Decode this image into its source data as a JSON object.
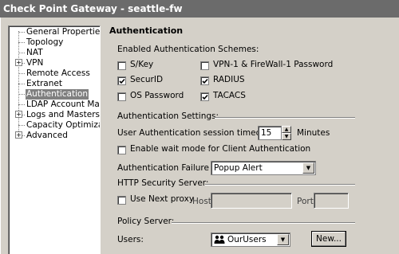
{
  "window": {
    "title": "Check Point Gateway - seattle-fw"
  },
  "tree": {
    "items": [
      {
        "label": "General Properties",
        "expandable": false
      },
      {
        "label": "Topology",
        "expandable": false
      },
      {
        "label": "NAT",
        "expandable": false
      },
      {
        "label": "VPN",
        "expandable": true
      },
      {
        "label": "Remote Access",
        "expandable": false
      },
      {
        "label": "Extranet",
        "expandable": false
      },
      {
        "label": "Authentication",
        "expandable": false,
        "selected": true
      },
      {
        "label": "LDAP Account Manage",
        "expandable": false
      },
      {
        "label": "Logs and Masters",
        "expandable": true
      },
      {
        "label": "Capacity Optimization",
        "expandable": false
      },
      {
        "label": "Advanced",
        "expandable": true
      }
    ],
    "expander_glyph": "+"
  },
  "panel": {
    "title": "Authentication",
    "schemes": {
      "heading": "Enabled Authentication Schemes:",
      "skey": {
        "label": "S/Key",
        "checked": false
      },
      "securid": {
        "label": "SecurID",
        "checked": true
      },
      "os_password": {
        "label": "OS Password",
        "checked": false
      },
      "vpn_fw_password": {
        "label": "VPN-1 & FireWall-1 Password",
        "checked": false
      },
      "radius": {
        "label": "RADIUS",
        "checked": true
      },
      "tacacs": {
        "label": "TACACS",
        "checked": true
      }
    },
    "settings": {
      "heading": "Authentication Settings:",
      "timeout_label": "User Authentication session timeout:",
      "timeout_value": "15",
      "timeout_unit": "Minutes",
      "wait_mode": {
        "label": "Enable wait mode for Client Authentication",
        "checked": false
      },
      "failure_track_label": "Authentication Failure Track:",
      "failure_track_value": "Popup Alert"
    },
    "http": {
      "heading": "HTTP Security Server:",
      "use_next_proxy": {
        "label": "Use Next proxy",
        "checked": false
      },
      "host_label": "Host:",
      "port_label": "Port:"
    },
    "policy": {
      "heading": "Policy Server:",
      "users_label": "Users:",
      "users_value": "OurUsers",
      "new_button": "New..."
    }
  },
  "colors": {
    "titlebar": "#6b6b6b",
    "dialog": "#d4d0c8",
    "selected": "#808080"
  }
}
